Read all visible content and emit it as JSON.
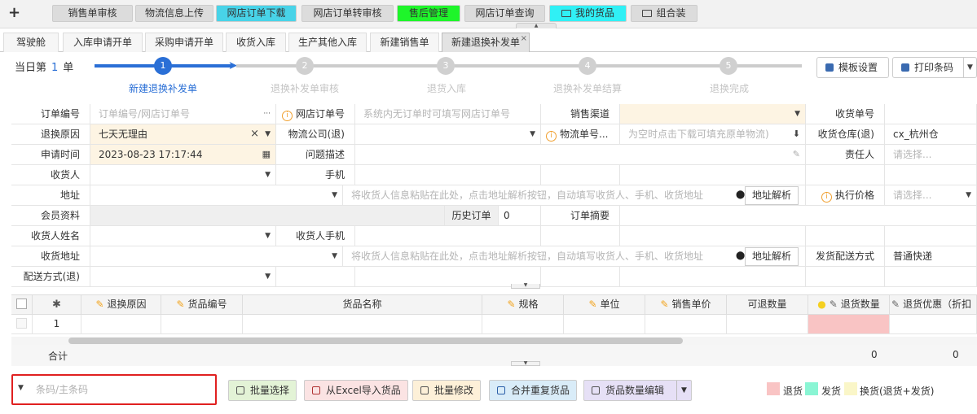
{
  "top_tabs": [
    {
      "label": "销售单审核",
      "color": "#dcdcdc"
    },
    {
      "label": "物流信息上传",
      "color": "#dcdcdc"
    },
    {
      "label": "网店订单下载",
      "color": "#48d3e8"
    },
    {
      "label": "网店订单转审核",
      "color": "#dcdcdc"
    },
    {
      "label": "售后管理",
      "color": "#1ef52a"
    },
    {
      "label": "网店订单查询",
      "color": "#dcdcdc"
    },
    {
      "label": "我的货品",
      "color": "#30f0f5",
      "icon": "folder-icon"
    },
    {
      "label": "组合装",
      "color": "#dcdcdc",
      "icon": "folder-icon"
    }
  ],
  "sub_tabs": [
    {
      "label": "驾驶舱"
    },
    {
      "label": "入库申请开单"
    },
    {
      "label": "采购申请开单"
    },
    {
      "label": "收货入库"
    },
    {
      "label": "生产其他入库"
    },
    {
      "label": "新建销售单"
    },
    {
      "label": "新建退换补发单",
      "active": true,
      "close": "×"
    }
  ],
  "steps": {
    "day_prefix": "当日第",
    "day_count": "1",
    "day_suffix": "单",
    "items": [
      {
        "num": "1",
        "label": "新建退换补发单",
        "active": true
      },
      {
        "num": "2",
        "label": "退换补发单审核",
        "active": false
      },
      {
        "num": "3",
        "label": "退货入库",
        "active": false
      },
      {
        "num": "4",
        "label": "退换补发单结算",
        "active": false
      },
      {
        "num": "5",
        "label": "退换完成",
        "active": false
      }
    ]
  },
  "toolbar": {
    "template_settings": "模板设置",
    "print_barcode": "打印条码"
  },
  "form": {
    "order_no_label": "订单编号",
    "order_no_placeholder": "订单编号/网店订单号",
    "order_no_more": "···",
    "shop_order_label": "网店订单号",
    "shop_order_placeholder": "系统内无订单时可填写网店订单号",
    "channel_label": "销售渠道",
    "receipt_no_label": "收货单号",
    "reason_label": "退换原因",
    "reason_value": "七天无理由",
    "reason_clear": "×",
    "logistics_company_label": "物流公司(退)",
    "logistics_no_label": "物流单号...",
    "logistics_no_placeholder": "为空时点击下载可填充原单物流)",
    "warehouse_label": "收货仓库(退)",
    "warehouse_value": "cx_杭州仓",
    "apply_time_label": "申请时间",
    "apply_time_value": "2023-08-23 17:17:44",
    "problem_label": "问题描述",
    "owner_label": "责任人",
    "owner_placeholder": "请选择...",
    "receiver_label": "收货人",
    "phone_label": "手机",
    "address_label": "地址",
    "address_placeholder": "将收货人信息粘贴在此处，点击地址解析按钮，自动填写收货人、手机、收货地址",
    "parse_button": "地址解析",
    "exec_price_label": "执行价格",
    "exec_price_placeholder": "请选择...",
    "member_label": "会员资料",
    "history_orders_label": "历史订单",
    "history_orders_value": "0",
    "order_summary_label": "订单摘要",
    "receiver_name_label": "收货人姓名",
    "receiver_phone_label": "收货人手机",
    "receive_address_label": "收货地址",
    "address2_placeholder": "将收货人信息粘贴在此处，点击地址解析按钮，自动填写收货人、手机、收货地址",
    "parse_button2": "地址解析",
    "ship_method_label": "发货配送方式",
    "ship_method_value": "普通快递",
    "return_ship_label": "配送方式(退)"
  },
  "grid": {
    "columns": [
      {
        "label": "退换原因",
        "pen": true
      },
      {
        "label": "货品编号",
        "pen": true
      },
      {
        "label": "货品名称",
        "pen": false
      },
      {
        "label": "规格",
        "pen": true
      },
      {
        "label": "单位",
        "pen": true
      },
      {
        "label": "销售单价",
        "pen": true
      },
      {
        "label": "可退数量",
        "pen": false
      },
      {
        "label": "退货数量",
        "pen": false,
        "bulb": true
      },
      {
        "label": "退货优惠（折扣",
        "pen": true
      }
    ],
    "row_no": "1",
    "total_label": "合计",
    "total_qty": "0",
    "total_discount": "0"
  },
  "bottom": {
    "barcode_placeholder": "条码/主条码",
    "batch_select": "批量选择",
    "import_excel": "从Excel导入货品",
    "batch_edit": "批量修改",
    "merge_duplicate": "合并重复货品",
    "qty_edit": "货品数量编辑",
    "legend": [
      {
        "label": "退货",
        "color": "#f9c4c4"
      },
      {
        "label": "发货",
        "color": "#8af5d4"
      },
      {
        "label": "换货(退货+发货)",
        "color": "#faf6c8"
      }
    ]
  }
}
